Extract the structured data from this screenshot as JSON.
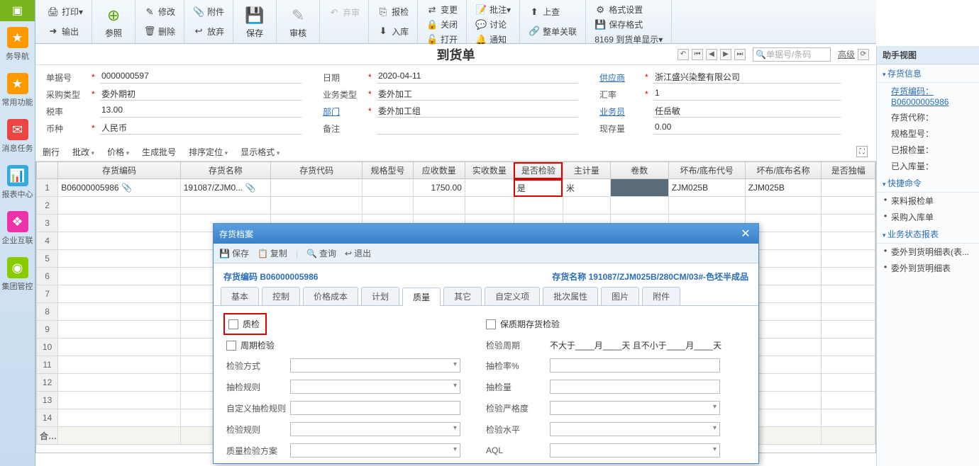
{
  "sidenav": {
    "items": [
      {
        "label": "务导航"
      },
      {
        "label": "常用功能"
      },
      {
        "label": "消息任务"
      },
      {
        "label": "报表中心"
      },
      {
        "label": "企业互联"
      },
      {
        "label": "集团管控"
      }
    ]
  },
  "ribbon": {
    "print": "打印",
    "output": "输出",
    "canzhao": "参照",
    "modify": "修改",
    "delete": "删除",
    "attachment": "附件",
    "fangqi": "放弃",
    "save": "保存",
    "shenhe": "审核",
    "qishen": "弃审",
    "baojian": "报检",
    "ruku": "入库",
    "biangeng": "变更",
    "guanbi": "关闭",
    "dakai": "打开",
    "pizhu": "批注",
    "taolun": "讨论",
    "tongzhi": "通知",
    "shangcha": "上查",
    "zhengdan": "整单关联",
    "geshi": "格式设置",
    "baocunfmt": "保存格式",
    "fmt_text": "8169 到货单显示"
  },
  "form": {
    "title": "到货单",
    "search_placeholder": "单据号/条码",
    "adv": "高级",
    "fields": {
      "doc_no_l": "单据号",
      "doc_no": "0000000597",
      "date_l": "日期",
      "date": "2020-04-11",
      "supplier_l": "供应商",
      "supplier": "浙江盛兴染整有限公司",
      "po_type_l": "采购类型",
      "po_type": "委外期初",
      "biz_type_l": "业务类型",
      "biz_type": "委外加工",
      "rate_l": "汇率",
      "rate": "1",
      "tax_l": "税率",
      "tax": "13.00",
      "dept_l": "部门",
      "dept": "委外加工组",
      "person_l": "业务员",
      "person": "任岳敏",
      "currency_l": "币种",
      "currency": "人民币",
      "remark_l": "备注",
      "remark": "",
      "cash_l": "现存量",
      "cash": "0.00"
    }
  },
  "grid_tb": {
    "del": "删行",
    "batch": "批改",
    "price": "价格",
    "gen": "生成批号",
    "sort": "排序定位",
    "disp": "显示格式"
  },
  "grid": {
    "cols": [
      "",
      "存货编码",
      "存货名称",
      "存货代码",
      "规格型号",
      "应收数量",
      "实收数量",
      "是否检验",
      "主计量",
      "卷数",
      "坏布/底布代号",
      "坏布/底布名称",
      "是否独幅"
    ],
    "row1": {
      "code": "B06000005986",
      "name": "191087/ZJM0...",
      "qty": "1750.00",
      "check": "是",
      "unit": "米",
      "bad_code": "ZJM025B",
      "bad_name": "ZJM025B"
    },
    "sum_label": "合计"
  },
  "rightpanel": {
    "title": "助手视图",
    "sec1": "存货信息",
    "s1_link_l": "存货编码：",
    "s1_link_v": "B06000005986",
    "s1_items": [
      "存货代称：",
      "规格型号：",
      "已报检量：",
      "已入库量："
    ],
    "sec2": "快捷命令",
    "s2_items": [
      "来料报检单",
      "采购入库单"
    ],
    "sec3": "业务状态报表",
    "s3_items": [
      "委外到货明细表(表...",
      "委外到货明细表"
    ]
  },
  "dialog": {
    "title": "存货档案",
    "tb": {
      "save": "保存",
      "copy": "复制",
      "query": "查询",
      "exit": "退出"
    },
    "head_code_l": "存货编码",
    "head_code": "B06000005986",
    "head_name_l": "存货名称",
    "head_name": "191087/ZJM025B/280CM/03#-色坯半成品",
    "tabs": [
      "基本",
      "控制",
      "价格成本",
      "计划",
      "质量",
      "其它",
      "自定义项",
      "批次属性",
      "图片",
      "附件"
    ],
    "active_tab": 4,
    "body": {
      "qc": "质检",
      "baozhi": "保质期存货检验",
      "zhouqi": "周期检验",
      "jyzhouqi_l": "检验周期",
      "jyzhouqi_v": "不大于____月____天 且不小于____月____天",
      "jyfs": "检验方式",
      "cjl": "抽检率%",
      "cjgz": "抽检规则",
      "cjliang": "抽检量",
      "zdy": "自定义抽检规则",
      "yange": "检验严格度",
      "jygz": "检验规则",
      "jysp": "检验水平",
      "zlfangan": "质量检验方案",
      "aql": "AQL"
    }
  }
}
